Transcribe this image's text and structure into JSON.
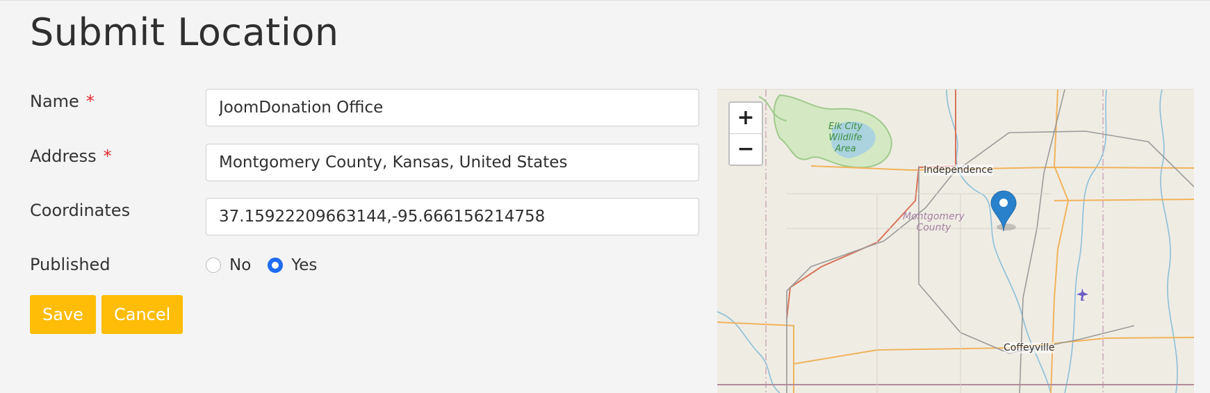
{
  "page": {
    "title": "Submit Location"
  },
  "form": {
    "name": {
      "label": "Name",
      "required_mark": "*",
      "value": "JoomDonation Office"
    },
    "address": {
      "label": "Address",
      "required_mark": "*",
      "value": "Montgomery County, Kansas, United States"
    },
    "coordinates": {
      "label": "Coordinates",
      "value": "37.15922209663144,-95.666156214758"
    },
    "published": {
      "label": "Published",
      "options": [
        {
          "label": "No",
          "checked": false
        },
        {
          "label": "Yes",
          "checked": true
        }
      ]
    },
    "buttons": {
      "save": "Save",
      "cancel": "Cancel"
    }
  },
  "map": {
    "zoom_in": "+",
    "zoom_out": "−",
    "places": {
      "independence": "Independence",
      "coffeyville": "Coffeyville",
      "county_line1": "Montgomery",
      "county_line2": "County",
      "park_line1": "Elk City",
      "park_line2": "Wildlife",
      "park_line3": "Area"
    },
    "icons": {
      "marker": "map-marker-icon",
      "airport": "airport-icon"
    },
    "colors": {
      "marker": "#2a81cb",
      "accent": "#ffbd07",
      "radio": "#1f6cf2",
      "required": "#e0282e"
    }
  }
}
